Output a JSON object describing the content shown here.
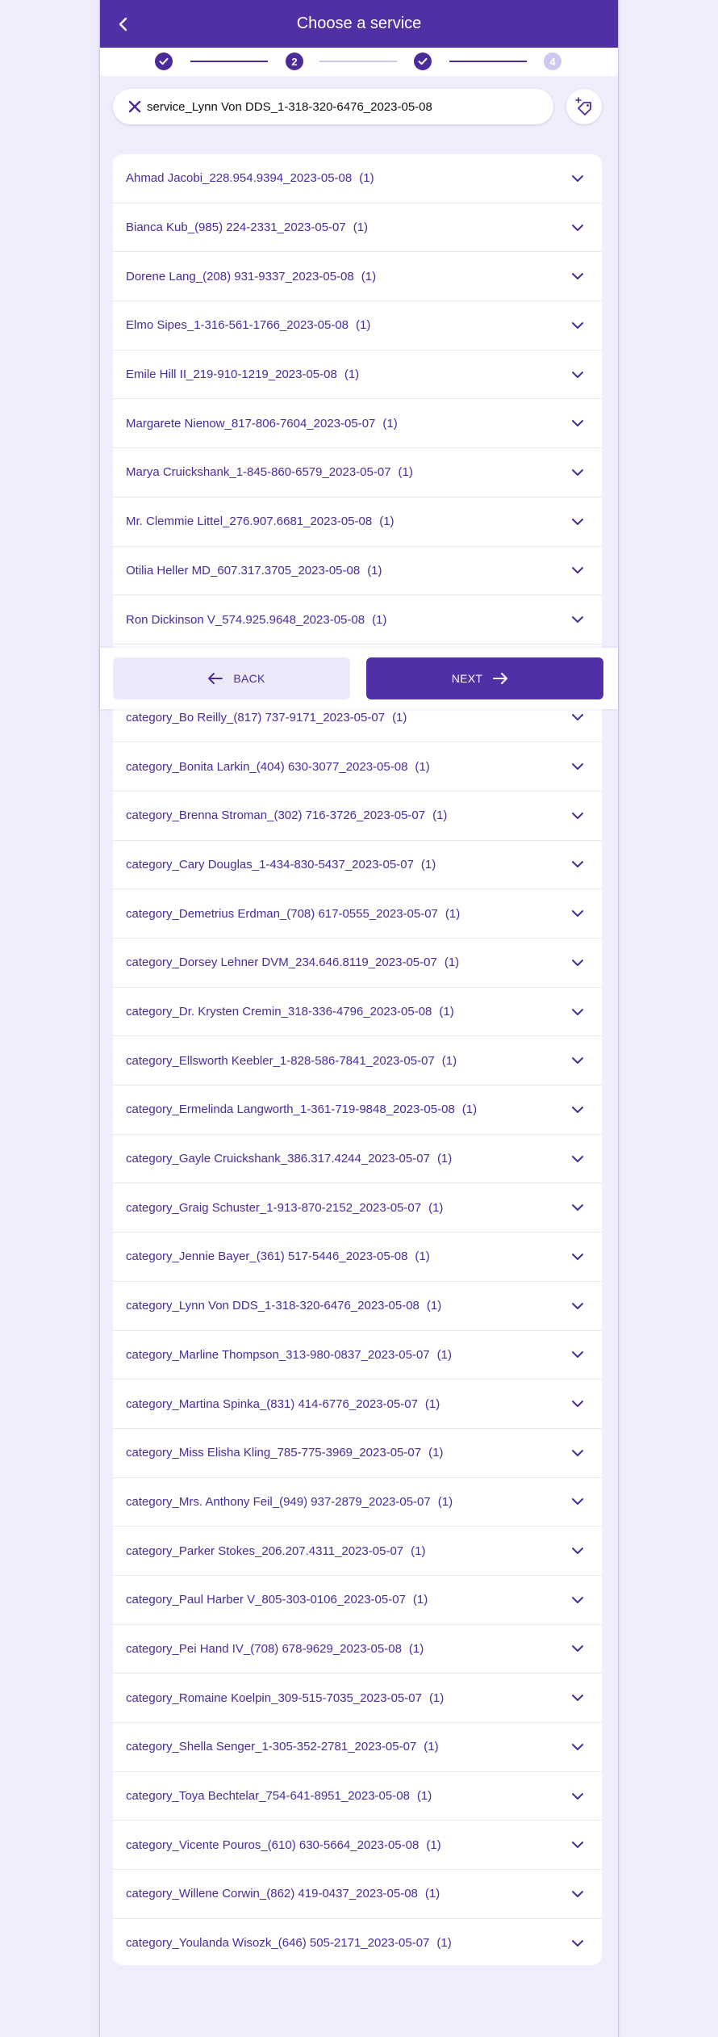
{
  "header": {
    "title": "Choose a service",
    "back_icon": "arrow-left-icon"
  },
  "stepper": {
    "steps": [
      {
        "state": "done",
        "label": ""
      },
      {
        "state": "current",
        "label": "2"
      },
      {
        "state": "done",
        "label": ""
      },
      {
        "state": "pending",
        "label": "4"
      }
    ]
  },
  "search": {
    "value": "service_Lynn Von DDS_1-318-320-6476_2023-05-08",
    "clear_icon": "close-icon",
    "tag_icon": "tag-sparkle-icon"
  },
  "list": {
    "items": [
      {
        "label": "Ahmad Jacobi_228.954.9394_2023-05-08",
        "count": "(1)"
      },
      {
        "label": "Bianca Kub_(985) 224-2331_2023-05-07",
        "count": "(1)"
      },
      {
        "label": "Dorene Lang_(208) 931-9337_2023-05-08",
        "count": "(1)"
      },
      {
        "label": "Elmo Sipes_1-316-561-1766_2023-05-08",
        "count": "(1)"
      },
      {
        "label": "Emile Hill II_219-910-1219_2023-05-08",
        "count": "(1)"
      },
      {
        "label": "Margarete Nienow_817-806-7604_2023-05-07",
        "count": "(1)"
      },
      {
        "label": "Marya Cruickshank_1-845-860-6579_2023-05-07",
        "count": "(1)"
      },
      {
        "label": "Mr. Clemmie Littel_276.907.6681_2023-05-08",
        "count": "(1)"
      },
      {
        "label": "Otilia Heller MD_607.317.3705_2023-05-08",
        "count": "(1)"
      },
      {
        "label": "Ron Dickinson V_574.925.9648_2023-05-08",
        "count": "(1)"
      },
      {
        "label": "",
        "count": ""
      },
      {
        "label": "category_Bo Reilly_(817) 737-9171_2023-05-07",
        "count": "(1)"
      },
      {
        "label": "category_Bonita Larkin_(404) 630-3077_2023-05-08",
        "count": "(1)"
      },
      {
        "label": "category_Brenna Stroman_(302) 716-3726_2023-05-07",
        "count": "(1)"
      },
      {
        "label": "category_Cary Douglas_1-434-830-5437_2023-05-07",
        "count": "(1)"
      },
      {
        "label": "category_Demetrius Erdman_(708) 617-0555_2023-05-07",
        "count": "(1)"
      },
      {
        "label": "category_Dorsey Lehner DVM_234.646.8119_2023-05-07",
        "count": "(1)"
      },
      {
        "label": "category_Dr. Krysten Cremin_318-336-4796_2023-05-08",
        "count": "(1)"
      },
      {
        "label": "category_Ellsworth Keebler_1-828-586-7841_2023-05-07",
        "count": "(1)"
      },
      {
        "label": "category_Ermelinda Langworth_1-361-719-9848_2023-05-08",
        "count": "(1)"
      },
      {
        "label": "category_Gayle Cruickshank_386.317.4244_2023-05-07",
        "count": "(1)"
      },
      {
        "label": "category_Graig Schuster_1-913-870-2152_2023-05-07",
        "count": "(1)"
      },
      {
        "label": "category_Jennie Bayer_(361) 517-5446_2023-05-08",
        "count": "(1)"
      },
      {
        "label": "category_Lynn Von DDS_1-318-320-6476_2023-05-08",
        "count": "(1)"
      },
      {
        "label": "category_Marline Thompson_313-980-0837_2023-05-07",
        "count": "(1)"
      },
      {
        "label": "category_Martina Spinka_(831) 414-6776_2023-05-07",
        "count": "(1)"
      },
      {
        "label": "category_Miss Elisha Kling_785-775-3969_2023-05-07",
        "count": "(1)"
      },
      {
        "label": "category_Mrs. Anthony Feil_(949) 937-2879_2023-05-07",
        "count": "(1)"
      },
      {
        "label": "category_Parker Stokes_206.207.4311_2023-05-07",
        "count": "(1)"
      },
      {
        "label": "category_Paul Harber V_805-303-0106_2023-05-07",
        "count": "(1)"
      },
      {
        "label": "category_Pei Hand IV_(708) 678-9629_2023-05-08",
        "count": "(1)"
      },
      {
        "label": "category_Romaine Koelpin_309-515-7035_2023-05-07",
        "count": "(1)"
      },
      {
        "label": "category_Shella Senger_1-305-352-2781_2023-05-07",
        "count": "(1)"
      },
      {
        "label": "category_Toya Bechtelar_754-641-8951_2023-05-08",
        "count": "(1)"
      },
      {
        "label": "category_Vicente Pouros_(610) 630-5664_2023-05-08",
        "count": "(1)"
      },
      {
        "label": "category_Willene Corwin_(862) 419-0437_2023-05-08",
        "count": "(1)"
      },
      {
        "label": "category_Youlanda Wisozk_(646) 505-2171_2023-05-07",
        "count": "(1)"
      }
    ],
    "expand_icon": "chevron-down-icon"
  },
  "nav": {
    "back_label": "BACK",
    "next_label": "NEXT",
    "back_icon": "arrow-left-icon",
    "next_icon": "arrow-right-icon"
  },
  "colors": {
    "primary": "#5030a4",
    "text_accent": "#4b2a9a",
    "background": "#efeefd",
    "step_pending": "#cfc8ee"
  }
}
